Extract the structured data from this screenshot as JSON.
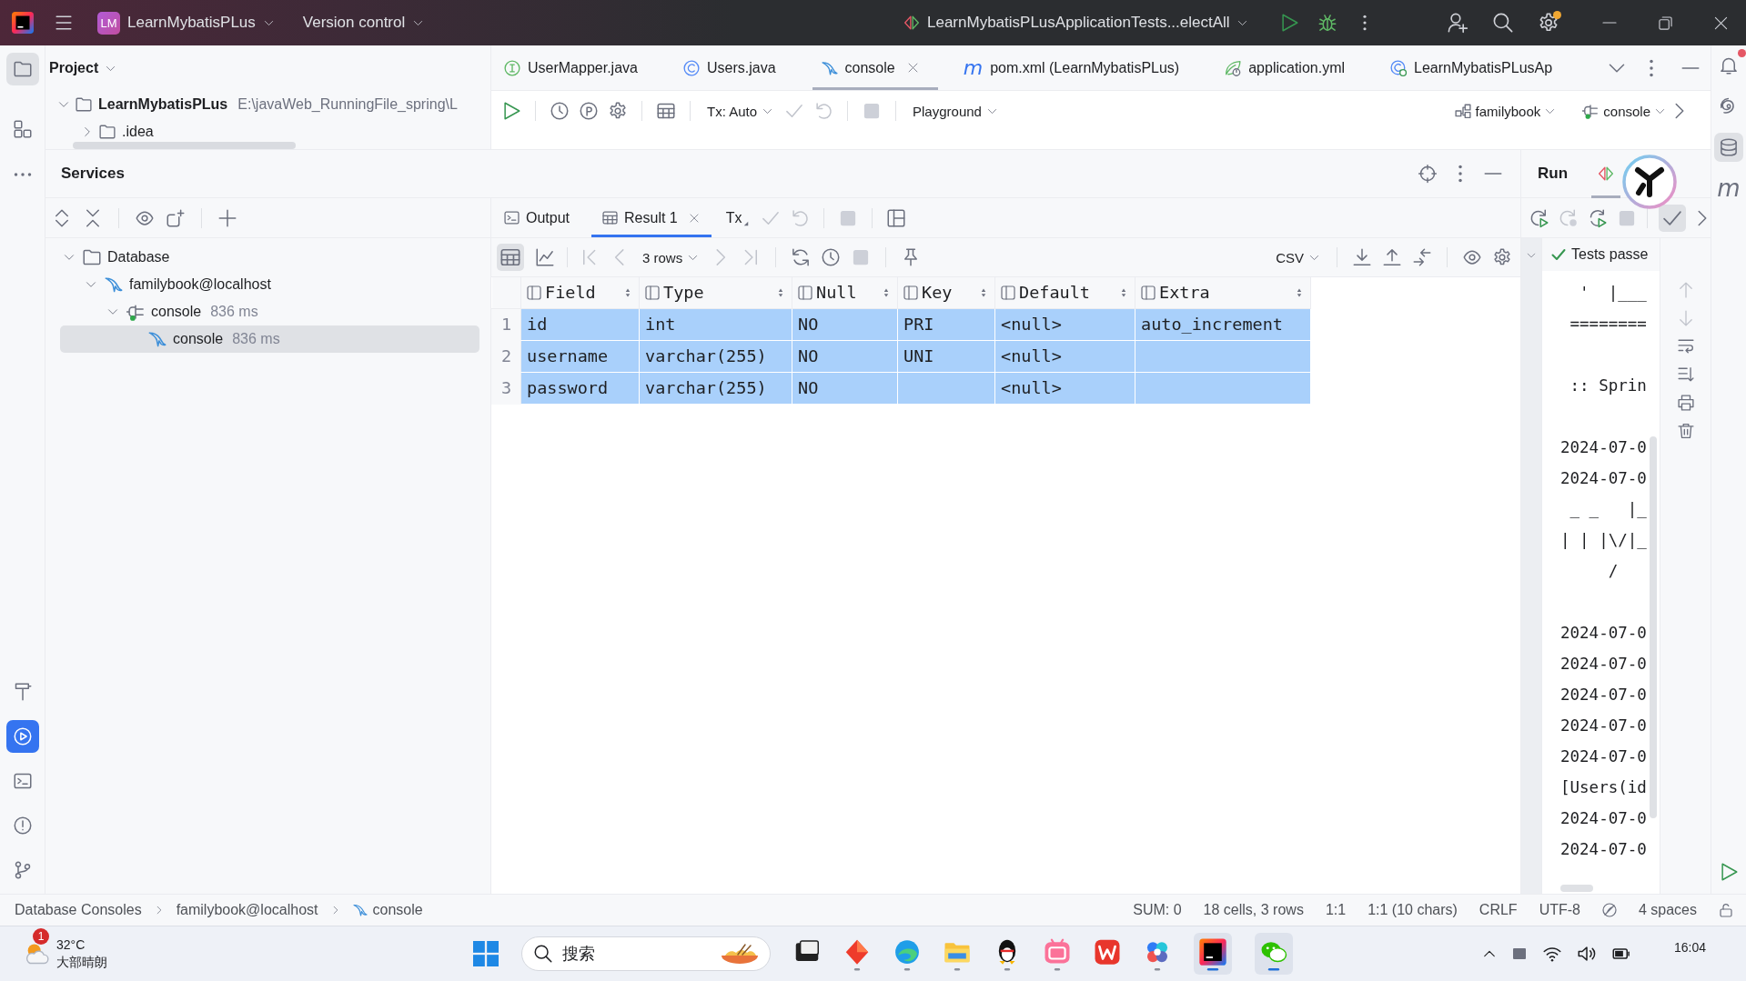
{
  "title_bar": {
    "project_badge": "LM",
    "project": "LearnMybatisPLus",
    "vcs": "Version control",
    "run_config": "LearnMybatisPLusApplicationTests...electAll",
    "settings_notice": true
  },
  "left_strip": {
    "top": [
      {
        "kind": "folder",
        "selected": true,
        "focused": false
      },
      {
        "kind": "structure",
        "selected": false,
        "focused": false
      },
      {
        "kind": "more",
        "selected": false,
        "focused": false
      }
    ],
    "bottom": [
      {
        "kind": "build",
        "selected": false,
        "focused": false
      },
      {
        "kind": "services",
        "selected": true,
        "focused": true
      },
      {
        "kind": "terminal",
        "selected": false,
        "focused": false
      },
      {
        "kind": "problems",
        "selected": false,
        "focused": false
      },
      {
        "kind": "git",
        "selected": false,
        "focused": false
      }
    ]
  },
  "project_panel": {
    "title": "Project",
    "tree": [
      {
        "label": "LearnMybatisPLus",
        "path": "E:\\javaWeb_RunningFile_spring\\L",
        "expanded": true,
        "children": [
          {
            "label": ".idea",
            "expanded": false
          }
        ]
      }
    ]
  },
  "editor_tabs": [
    {
      "kind": "interface",
      "label": "UserMapper.java",
      "selected": false
    },
    {
      "kind": "class",
      "label": "Users.java",
      "selected": false
    },
    {
      "kind": "console",
      "label": "console",
      "selected": true
    },
    {
      "kind": "maven",
      "glyph": "m",
      "label": "pom.xml (LearnMybatisPLus)",
      "selected": false
    },
    {
      "kind": "spring",
      "label": "application.yml",
      "selected": false
    },
    {
      "kind": "test",
      "label": "LearnMybatisPLusAp",
      "selected": false
    }
  ],
  "console_toolbar": [
    [
      {
        "kind": "run",
        "disabled": false
      }
    ],
    [
      {
        "kind": "history",
        "disabled": false
      },
      {
        "kind": "explain",
        "disabled": false
      },
      {
        "kind": "settings",
        "disabled": false
      }
    ],
    [
      {
        "kind": "table",
        "disabled": false
      }
    ],
    [
      {
        "kind": "dropdown",
        "label": "Tx: Auto",
        "disabled": false
      },
      {
        "kind": "commit",
        "disabled": true
      },
      {
        "kind": "rollback",
        "disabled": true
      }
    ],
    [
      {
        "kind": "stop",
        "disabled": true
      }
    ],
    [
      {
        "kind": "dropdown",
        "label": "Playground",
        "disabled": false
      }
    ]
  ],
  "console_selectors": [
    {
      "kind": "schema",
      "label": "familybook"
    },
    {
      "kind": "session",
      "label": "console"
    }
  ],
  "services_panel": {
    "title": "Services",
    "toolbar": [
      [
        {
          "kind": "expand_all",
          "disabled": false
        },
        {
          "kind": "collapse_all",
          "disabled": false
        }
      ],
      [
        {
          "kind": "view",
          "disabled": false
        },
        {
          "kind": "new_tab",
          "disabled": false
        }
      ],
      [
        {
          "kind": "add",
          "disabled": false
        }
      ]
    ],
    "tree": [
      {
        "kind": "folder",
        "label": "Database",
        "expanded": true,
        "selected": false,
        "children": [
          {
            "kind": "datasource",
            "label": "familybook@localhost",
            "expanded": true,
            "selected": false,
            "children": [
              {
                "kind": "session",
                "label": "console",
                "time": "836 ms",
                "expanded": true,
                "selected": false,
                "children": [
                  {
                    "kind": "console",
                    "label": "console",
                    "time": "836 ms",
                    "selected": true
                  }
                ]
              }
            ]
          }
        ]
      }
    ]
  },
  "result_tabs": [
    {
      "kind": "output",
      "label": "Output",
      "selected": false
    },
    {
      "kind": "result",
      "label": "Result 1",
      "selected": true
    }
  ],
  "result_tab_actions": [
    [
      {
        "kind": "tx",
        "label": "Tx",
        "disabled": false
      },
      {
        "kind": "commit",
        "disabled": true
      },
      {
        "kind": "rollback",
        "disabled": true
      }
    ],
    [
      {
        "kind": "stop",
        "disabled": true
      }
    ],
    [
      {
        "kind": "layout",
        "disabled": false
      }
    ]
  ],
  "view_modes": [
    {
      "kind": "table",
      "selected": true
    },
    {
      "kind": "chart",
      "selected": false
    }
  ],
  "result_toolbar": {
    "left": [
      [
        {
          "kind": "first",
          "disabled": true
        },
        {
          "kind": "prev",
          "disabled": true
        },
        {
          "kind": "dropdown",
          "label": "3 rows",
          "disabled": false
        },
        {
          "kind": "next",
          "disabled": true
        },
        {
          "kind": "last",
          "disabled": true
        }
      ],
      [
        {
          "kind": "refresh",
          "disabled": false
        },
        {
          "kind": "history",
          "disabled": false
        },
        {
          "kind": "stop",
          "disabled": true
        }
      ],
      [
        {
          "kind": "pin",
          "disabled": false
        }
      ]
    ],
    "right": [
      [
        {
          "kind": "dropdown",
          "label": "CSV",
          "disabled": false
        }
      ],
      [
        {
          "kind": "download",
          "disabled": false
        },
        {
          "kind": "upload",
          "disabled": false
        },
        {
          "kind": "compare",
          "disabled": false
        }
      ],
      [
        {
          "kind": "view",
          "disabled": false
        },
        {
          "kind": "settings",
          "disabled": false
        }
      ]
    ]
  },
  "table": {
    "columns": [
      "Field",
      "Type",
      "Null",
      "Key",
      "Default",
      "Extra"
    ],
    "rows": [
      {
        "number": "1",
        "selected": true,
        "cells": [
          "id",
          "int",
          "NO",
          "PRI",
          "<null>",
          "auto_increment"
        ]
      },
      {
        "number": "2",
        "selected": true,
        "cells": [
          "username",
          "varchar(255)",
          "NO",
          "UNI",
          "<null>",
          null
        ]
      },
      {
        "number": "3",
        "selected": true,
        "cells": [
          "password",
          "varchar(255)",
          "NO",
          null,
          "<null>",
          null
        ]
      }
    ]
  },
  "run_panel": {
    "title": "Run",
    "toolbar": [
      [
        {
          "kind": "rerun",
          "disabled": false
        },
        {
          "kind": "rerun_failed",
          "disabled": true
        },
        {
          "kind": "toggle_auto",
          "disabled": false
        },
        {
          "kind": "stop",
          "disabled": true
        }
      ]
    ],
    "passed_filter": {
      "selected": true
    },
    "status": "Tests passe",
    "console": [
      [
        "  '  |___",
        " ========"
      ],
      [
        " :: Sprin"
      ],
      [
        "2024-07-0",
        "2024-07-0",
        " _ _   |_",
        "| | |\\/|_",
        "     /"
      ],
      [
        "2024-07-0",
        "2024-07-0",
        "2024-07-0",
        "2024-07-0",
        "2024-07-0",
        "[Users(id",
        "2024-07-0",
        "2024-07-0"
      ]
    ],
    "actions": [
      {
        "kind": "up",
        "disabled": true
      },
      {
        "kind": "down",
        "disabled": true
      },
      {
        "kind": "wrap",
        "disabled": false
      },
      {
        "kind": "scroll_end",
        "disabled": false
      },
      {
        "kind": "print",
        "disabled": false
      },
      {
        "kind": "clear",
        "disabled": false
      }
    ]
  },
  "right_strip": {
    "notifications_unread": true,
    "top": [
      {
        "kind": "notifications",
        "selected": false
      },
      {
        "kind": "ai",
        "selected": false
      },
      {
        "kind": "database",
        "selected": true
      },
      {
        "kind": "maven",
        "glyph": "m",
        "selected": false
      }
    ],
    "bottom": [
      {
        "kind": "run",
        "selected": false
      }
    ]
  },
  "status_bar": {
    "breadcrumbs": [
      {
        "kind": "plain",
        "label": "Database Consoles"
      },
      {
        "kind": "plain",
        "label": "familybook@localhost"
      },
      {
        "kind": "console",
        "label": "console"
      }
    ],
    "items": [
      "SUM: 0",
      "18 cells, 3 rows",
      "1:1",
      "1:1 (10 chars)",
      "CRLF",
      "UTF-8",
      "4 spaces"
    ]
  },
  "taskbar": {
    "weather": {
      "badge": "1",
      "temperature": "32°C",
      "condition": "大部晴朗"
    },
    "search": {
      "placeholder": "搜索"
    },
    "apps": [
      {
        "kind": "taskview",
        "running": false,
        "active": false
      },
      {
        "kind": "diamond",
        "running": true,
        "active": false
      },
      {
        "kind": "browser",
        "running": true,
        "active": false
      },
      {
        "kind": "files",
        "running": true,
        "active": false
      },
      {
        "kind": "penguin",
        "running": true,
        "active": false
      },
      {
        "kind": "video",
        "running": true,
        "active": false
      },
      {
        "kind": "office",
        "running": false,
        "active": false
      },
      {
        "kind": "pinwheel",
        "running": true,
        "active": false
      },
      {
        "kind": "ide",
        "running": true,
        "active": true
      },
      {
        "kind": "chat",
        "running": true,
        "active": true
      }
    ],
    "time": "16:04"
  }
}
